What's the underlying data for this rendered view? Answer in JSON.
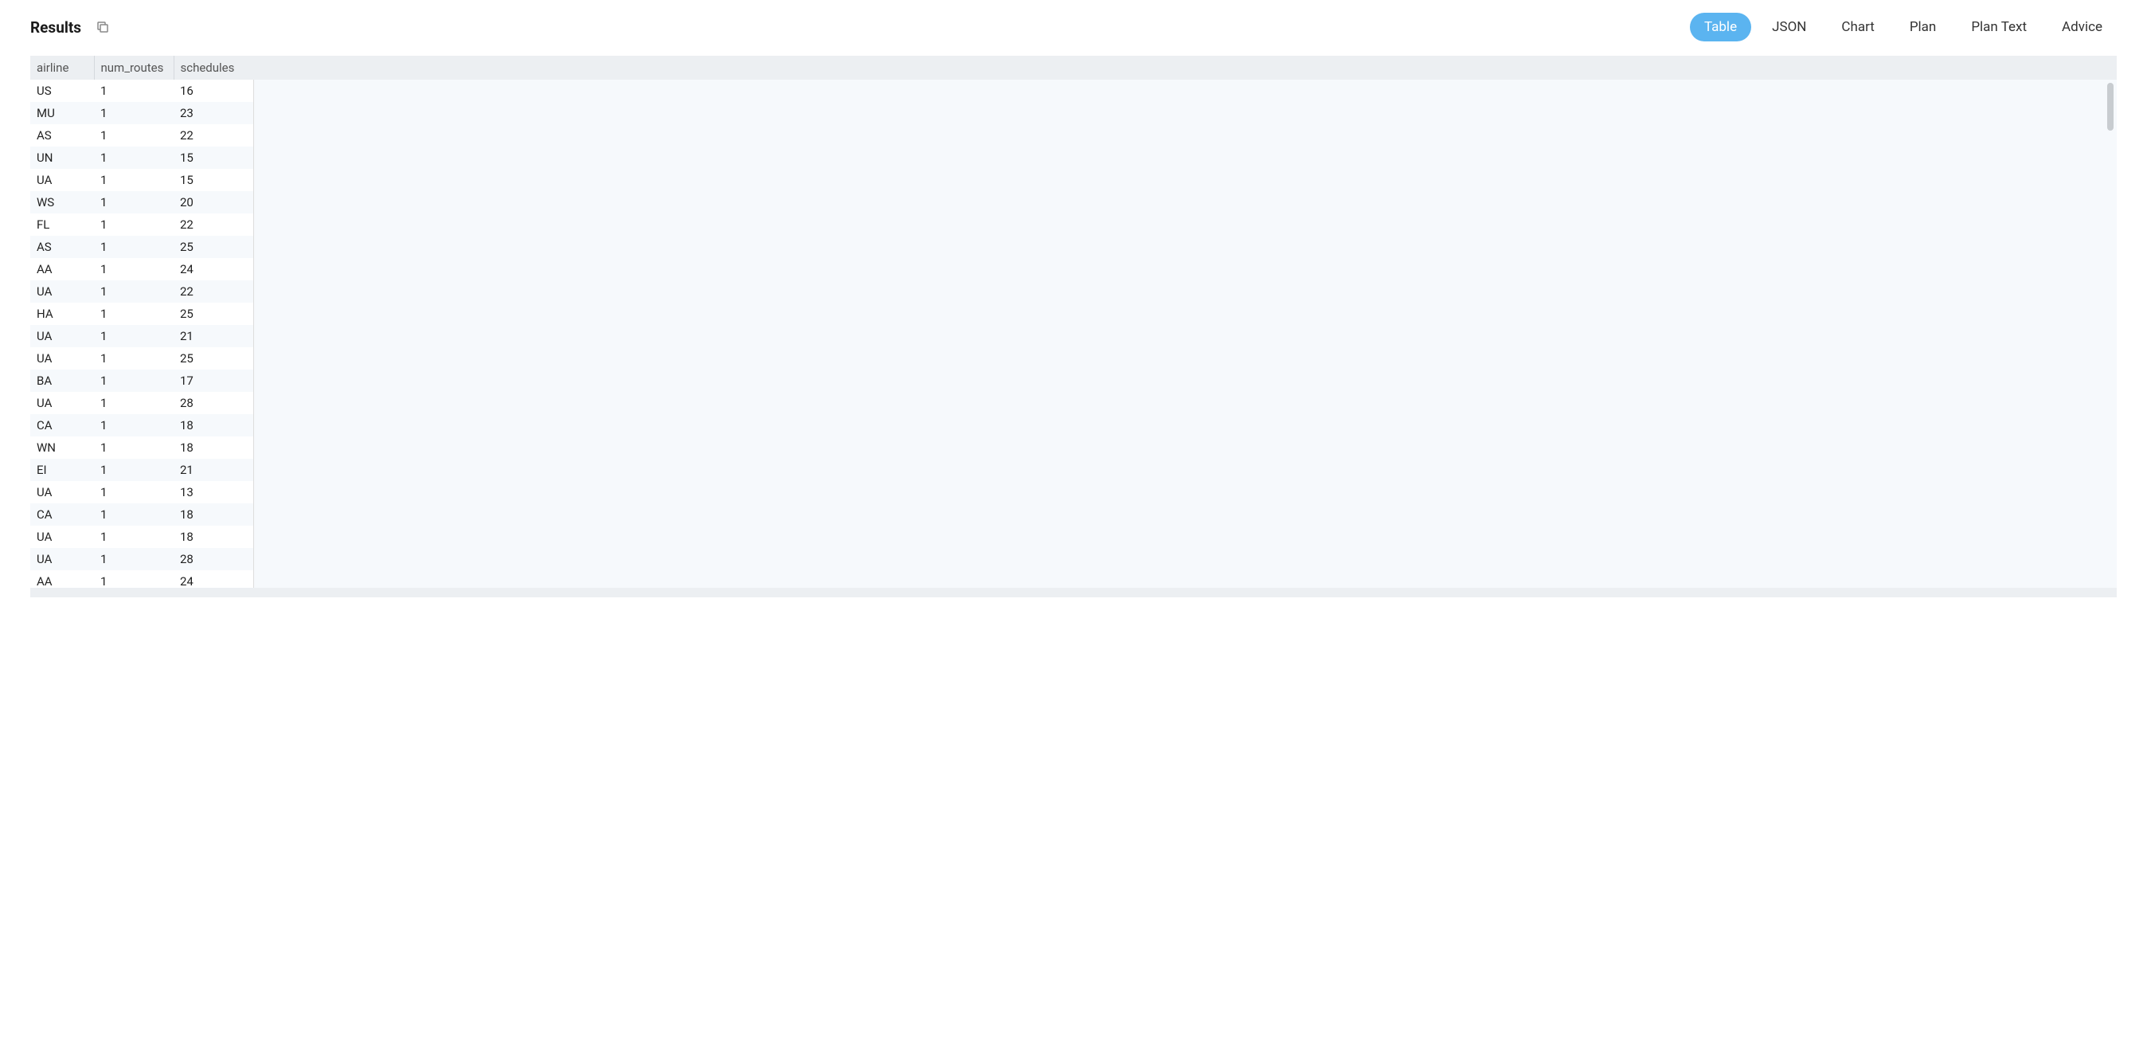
{
  "header": {
    "title": "Results"
  },
  "tabs": [
    {
      "label": "Table",
      "active": true
    },
    {
      "label": "JSON",
      "active": false
    },
    {
      "label": "Chart",
      "active": false
    },
    {
      "label": "Plan",
      "active": false
    },
    {
      "label": "Plan Text",
      "active": false
    },
    {
      "label": "Advice",
      "active": false
    }
  ],
  "table": {
    "columns": [
      "airline",
      "num_routes",
      "schedules"
    ],
    "rows": [
      {
        "airline": "US",
        "num_routes": "1",
        "schedules": "16"
      },
      {
        "airline": "MU",
        "num_routes": "1",
        "schedules": "23"
      },
      {
        "airline": "AS",
        "num_routes": "1",
        "schedules": "22"
      },
      {
        "airline": "UN",
        "num_routes": "1",
        "schedules": "15"
      },
      {
        "airline": "UA",
        "num_routes": "1",
        "schedules": "15"
      },
      {
        "airline": "WS",
        "num_routes": "1",
        "schedules": "20"
      },
      {
        "airline": "FL",
        "num_routes": "1",
        "schedules": "22"
      },
      {
        "airline": "AS",
        "num_routes": "1",
        "schedules": "25"
      },
      {
        "airline": "AA",
        "num_routes": "1",
        "schedules": "24"
      },
      {
        "airline": "UA",
        "num_routes": "1",
        "schedules": "22"
      },
      {
        "airline": "HA",
        "num_routes": "1",
        "schedules": "25"
      },
      {
        "airline": "UA",
        "num_routes": "1",
        "schedules": "21"
      },
      {
        "airline": "UA",
        "num_routes": "1",
        "schedules": "25"
      },
      {
        "airline": "BA",
        "num_routes": "1",
        "schedules": "17"
      },
      {
        "airline": "UA",
        "num_routes": "1",
        "schedules": "28"
      },
      {
        "airline": "CA",
        "num_routes": "1",
        "schedules": "18"
      },
      {
        "airline": "WN",
        "num_routes": "1",
        "schedules": "18"
      },
      {
        "airline": "EI",
        "num_routes": "1",
        "schedules": "21"
      },
      {
        "airline": "UA",
        "num_routes": "1",
        "schedules": "13"
      },
      {
        "airline": "CA",
        "num_routes": "1",
        "schedules": "18"
      },
      {
        "airline": "UA",
        "num_routes": "1",
        "schedules": "18"
      },
      {
        "airline": "UA",
        "num_routes": "1",
        "schedules": "28"
      },
      {
        "airline": "AA",
        "num_routes": "1",
        "schedules": "24"
      }
    ]
  }
}
